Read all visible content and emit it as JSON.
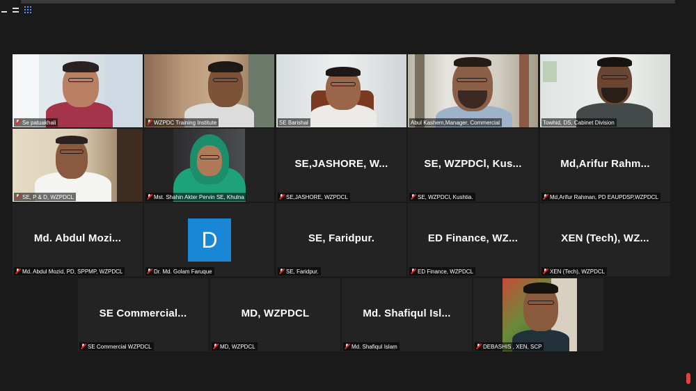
{
  "meeting": {
    "view_controls": [
      "minimize-icon",
      "speaker-view-icon",
      "gallery-view-icon"
    ],
    "accent_color": "#d4e85a"
  },
  "participants": [
    {
      "label": "Se patuakhali",
      "muted": true,
      "video": true
    },
    {
      "label": "WZPDC Training Institute",
      "muted": true,
      "video": true
    },
    {
      "label": "SE Barishal",
      "muted": false,
      "video": true
    },
    {
      "label": "Abul Kashem,Manager, Commercial",
      "muted": false,
      "video": true,
      "active_speaker": true
    },
    {
      "label": "Towhid, DS, Cabinet Division",
      "muted": false,
      "video": true
    },
    {
      "label": "SE, P & D, WZPDCL",
      "muted": true,
      "video": true
    },
    {
      "label": "Mst. Shahin Akter Pervin SE, Khulna",
      "muted": true,
      "video": true
    },
    {
      "label": "SE,JASHORE, WZPDCL",
      "display_name": "SE,JASHORE,  W...",
      "muted": true,
      "video": false
    },
    {
      "label": "SE, WZPDCl, Kushtia.",
      "display_name": "SE,  WZPDCl,  Kus...",
      "muted": true,
      "video": false
    },
    {
      "label": "Md,Arifur Rahman, PD EAUPDSP,WZPDCL",
      "display_name": "Md,Arifur  Rahm...",
      "muted": true,
      "video": false
    },
    {
      "label": "Md. Abdul Mozid, PD, SPPMP, WZPDCL",
      "display_name": "Md.  Abdul  Mozi...",
      "muted": true,
      "video": false
    },
    {
      "label": "Dr. Md. Golam Faruque",
      "avatar_letter": "D",
      "avatar_color": "#1a86d6",
      "muted": true,
      "video": false
    },
    {
      "label": "SE, Faridpur.",
      "display_name": "SE,  Faridpur.",
      "muted": true,
      "video": false
    },
    {
      "label": "ED Finance, WZPDCL",
      "display_name": "ED  Finance,  WZ...",
      "muted": true,
      "video": false
    },
    {
      "label": "XEN (Tech), WZPDCL",
      "display_name": "XEN  (Tech),  WZ...",
      "muted": true,
      "video": false
    },
    {
      "label": "SE Commercial WZPDCL",
      "display_name": "SE  Commercial...",
      "muted": true,
      "video": false
    },
    {
      "label": "MD, WZPDCL",
      "display_name": "MD,  WZPDCL",
      "muted": true,
      "video": false
    },
    {
      "label": "Md. Shafiqul Islam",
      "display_name": "Md.  Shafiqul  Isl...",
      "muted": true,
      "video": false
    },
    {
      "label": "DEBASHIS , XEN, SCP",
      "muted": true,
      "video": true
    }
  ]
}
